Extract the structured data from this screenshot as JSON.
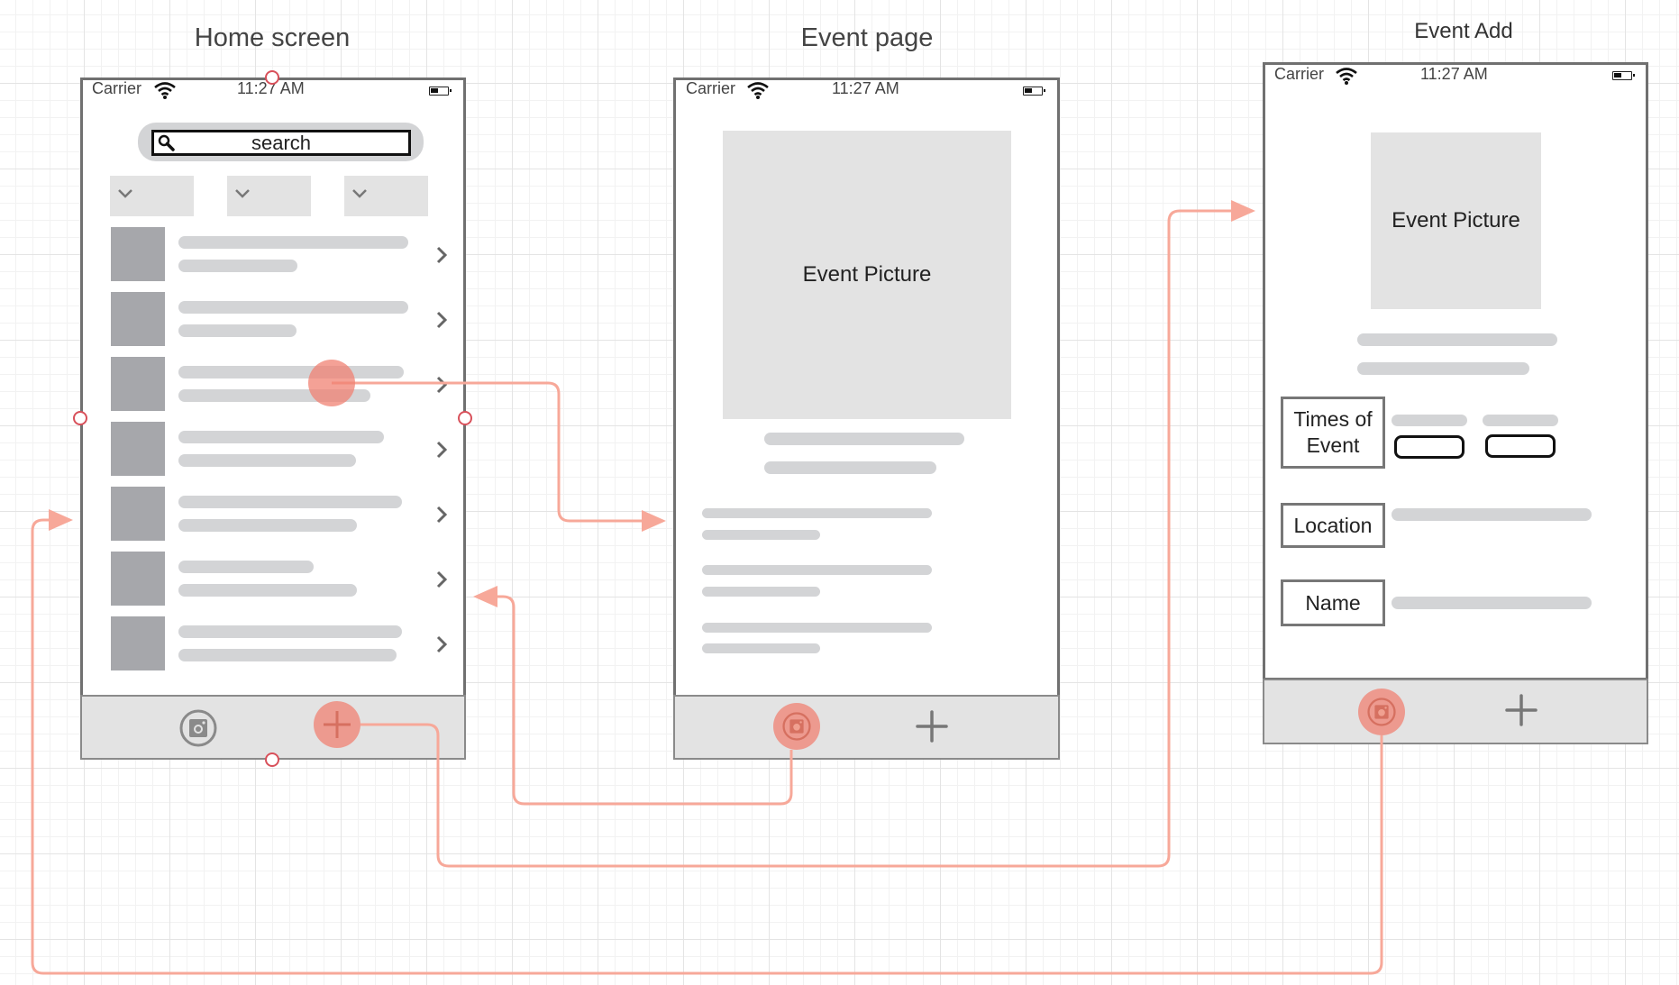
{
  "screens": {
    "home": {
      "title": "Home screen",
      "status": {
        "carrier": "Carrier",
        "time": "11:27 AM"
      },
      "search": {
        "placeholder": "search",
        "icon": "search-icon"
      },
      "filters": [
        {
          "icon": "chevron-down-icon"
        },
        {
          "icon": "chevron-down-icon"
        },
        {
          "icon": "chevron-down-icon"
        }
      ],
      "list_item_count": 7,
      "tabbar": [
        {
          "icon": "instagram-icon"
        },
        {
          "icon": "plus-icon",
          "highlighted": true
        }
      ]
    },
    "event_page": {
      "title": "Event page",
      "status": {
        "carrier": "Carrier",
        "time": "11:27 AM"
      },
      "picture_label": "Event Picture",
      "tabbar": [
        {
          "icon": "instagram-icon",
          "highlighted": true
        },
        {
          "icon": "plus-icon"
        }
      ]
    },
    "event_add": {
      "title": "Event Add",
      "status": {
        "carrier": "Carrier",
        "time": "11:27 AM"
      },
      "picture_label": "Event Picture",
      "fields": {
        "times": "Times of Event",
        "location": "Location",
        "name": "Name"
      },
      "tabbar": [
        {
          "icon": "instagram-icon",
          "highlighted": true
        },
        {
          "icon": "plus-icon"
        }
      ]
    }
  },
  "connectors": [
    {
      "from": "home.list_item_3",
      "to": "event_page"
    },
    {
      "from": "home.tab_plus",
      "to": "event_add"
    },
    {
      "from": "event_page.tab_instagram",
      "to": "home"
    },
    {
      "from": "event_add.tab_instagram",
      "to": "home"
    }
  ],
  "colors": {
    "connector": "#f7a899",
    "hotspot": "#f08273",
    "handle": "#d8505a"
  }
}
